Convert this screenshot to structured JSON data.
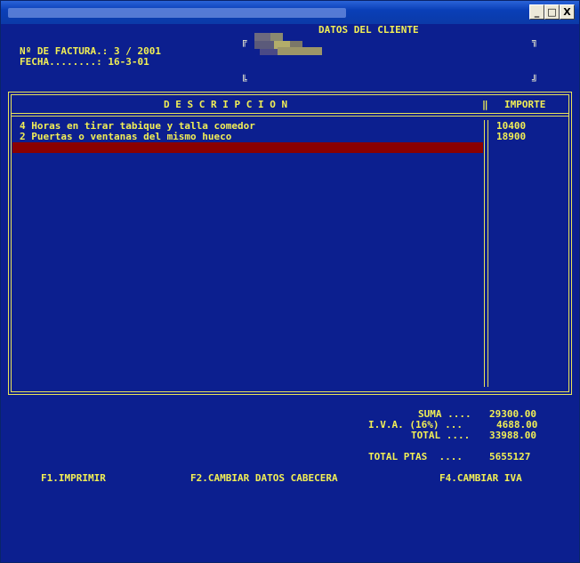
{
  "window": {
    "minimize_label": "_",
    "maximize_label": "□",
    "close_label": "X"
  },
  "header": {
    "invoice_label": "Nº DE FACTURA.: 3 / 2001",
    "date_label": "FECHA........: 16-3-01",
    "client_title": "DATOS DEL CLIENTE",
    "corner_tl": "╔",
    "corner_tr": "╗",
    "corner_bl": "╚",
    "corner_br": "╝"
  },
  "table": {
    "col_description": "D E S C R I P C I O N",
    "col_separator": "‖",
    "col_amount": "IMPORTE",
    "rows": [
      {
        "description": "4 Horas en tirar tabique y talla comedor",
        "amount": "10400"
      },
      {
        "description": "2 Puertas o ventanas del mismo hueco",
        "amount": "18900"
      },
      {
        "description": "",
        "amount": ""
      }
    ]
  },
  "totals": {
    "suma_label": "SUMA ....",
    "suma_value": "29300.00",
    "iva_label": "I.V.A. (16%) ...",
    "iva_value": "4688.00",
    "total_label": "TOTAL ....",
    "total_value": "33988.00",
    "total_ptas_label": "TOTAL PTAS  ....",
    "total_ptas_value": "5655127"
  },
  "fkeys": {
    "f1": "F1.IMPRIMIR",
    "f2": "F2.CAMBIAR DATOS CABECERA",
    "f4": "F4.CAMBIAR IVA"
  },
  "colors": {
    "background": "#0c1f8f",
    "text": "#f2ef55",
    "selection": "#8a0000"
  }
}
